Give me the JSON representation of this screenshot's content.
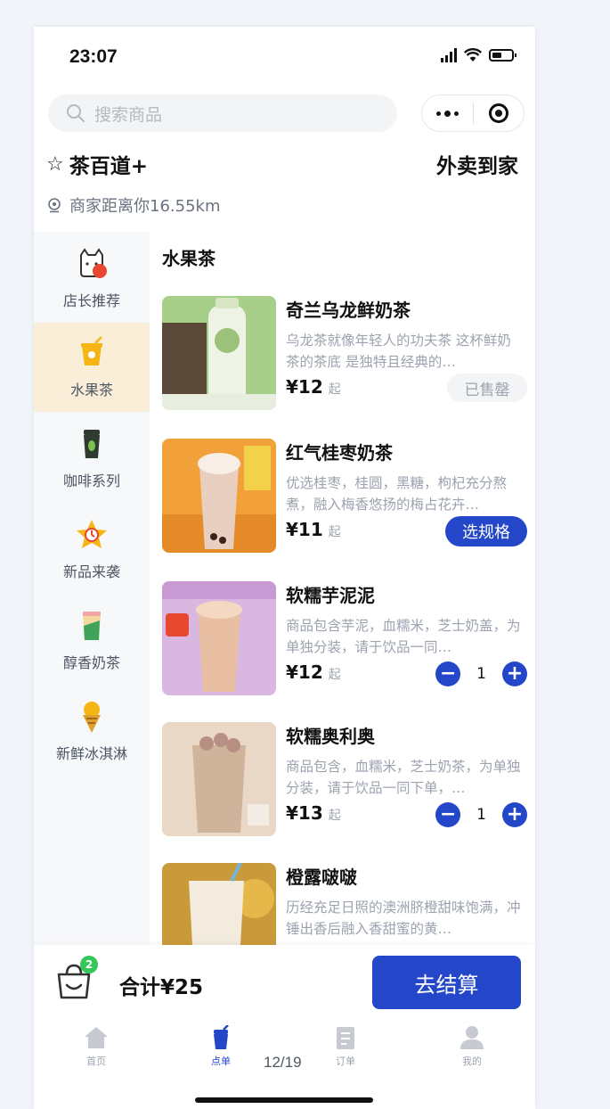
{
  "status_bar": {
    "time": "23:07"
  },
  "search": {
    "placeholder": "搜索商品"
  },
  "shop": {
    "name": "茶百道+",
    "delivery": "外卖到家",
    "distance": "商家距离你16.55km"
  },
  "categories": [
    {
      "label": "店长推荐",
      "icon": "cat-shopkeeper-icon"
    },
    {
      "label": "水果茶",
      "icon": "fruit-tea-icon",
      "active": true
    },
    {
      "label": "咖啡系列",
      "icon": "coffee-icon"
    },
    {
      "label": "新品来袭",
      "icon": "new-star-icon"
    },
    {
      "label": "醇香奶茶",
      "icon": "milk-tea-icon"
    },
    {
      "label": "新鲜冰淇淋",
      "icon": "ice-cream-icon"
    }
  ],
  "section_title": "水果茶",
  "products": [
    {
      "name": "奇兰乌龙鲜奶茶",
      "desc": "乌龙茶就像年轻人的功夫茶 这杯鲜奶茶的茶底 是独特且经典的…",
      "price": "¥12",
      "suffix": "起",
      "action": "已售罄"
    },
    {
      "name": "红气桂枣奶茶",
      "desc": "优选桂枣，桂圆，黑糖，枸杞充分熬煮，融入梅香悠扬的梅占花卉…",
      "price": "¥11",
      "suffix": "起",
      "action": "选规格"
    },
    {
      "name": "软糯芋泥泥",
      "desc": "商品包含芋泥，血糯米，芝士奶盖，为单独分装，请于饮品一同…",
      "price": "¥12",
      "suffix": "起",
      "qty": "1"
    },
    {
      "name": "软糯奥利奥",
      "desc": "商品包含，血糯米，芝士奶茶，为单独分装，请于饮品一同下单，…",
      "price": "¥13",
      "suffix": "起",
      "qty": "1"
    },
    {
      "name": "橙露啵啵",
      "desc": "历经充足日照的澳洲脐橙甜味饱满，冲锤出香后融入香甜蜜的黄…"
    }
  ],
  "cart": {
    "count": "2",
    "total": "合计¥25",
    "checkout": "去结算"
  },
  "tabs": [
    {
      "label": "首页"
    },
    {
      "label": "点单",
      "active": true
    },
    {
      "label": "订单"
    },
    {
      "label": "我的"
    }
  ],
  "pager": "12/19",
  "colors": {
    "accent": "#2347c8",
    "active_category_bg": "#fbeed9",
    "badge": "#34c759"
  }
}
